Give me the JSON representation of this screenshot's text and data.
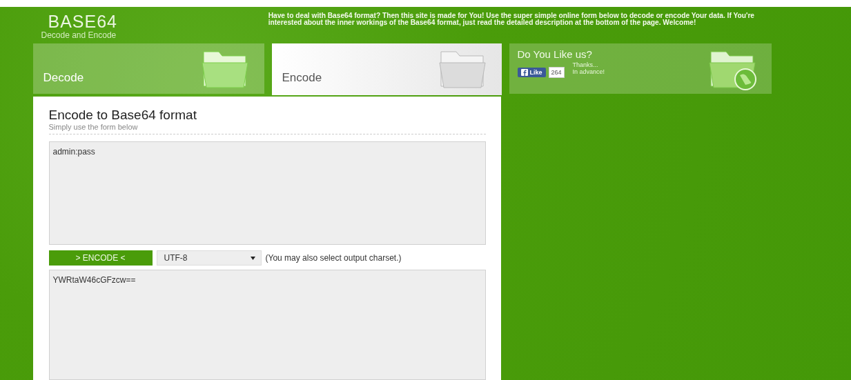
{
  "logo": {
    "title": "BASE64",
    "subtitle": "Decode and Encode"
  },
  "intro": "Have to deal with Base64 format? Then this site is made for You! Use the super simple online form below to decode or encode Your data. If You're interested about the inner workings of the Base64 format, just read the detailed description at the bottom of the page. Welcome!",
  "tabs": [
    {
      "label": "Decode",
      "selected": false
    },
    {
      "label": "Encode",
      "selected": true
    }
  ],
  "like_box": {
    "title": "Do You Like us?",
    "like_button": "Like",
    "like_count": "264",
    "thanks": "Thanks...",
    "thanks_line2": "In advance!"
  },
  "form": {
    "title": "Encode to Base64 format",
    "subtitle": "Simply use the form below",
    "input_value": "admin:pass",
    "button": "> ENCODE <",
    "charset": "UTF-8",
    "charset_note": "(You may also select output charset.)",
    "output_value": "YWRtaW46cGFzcw=="
  }
}
